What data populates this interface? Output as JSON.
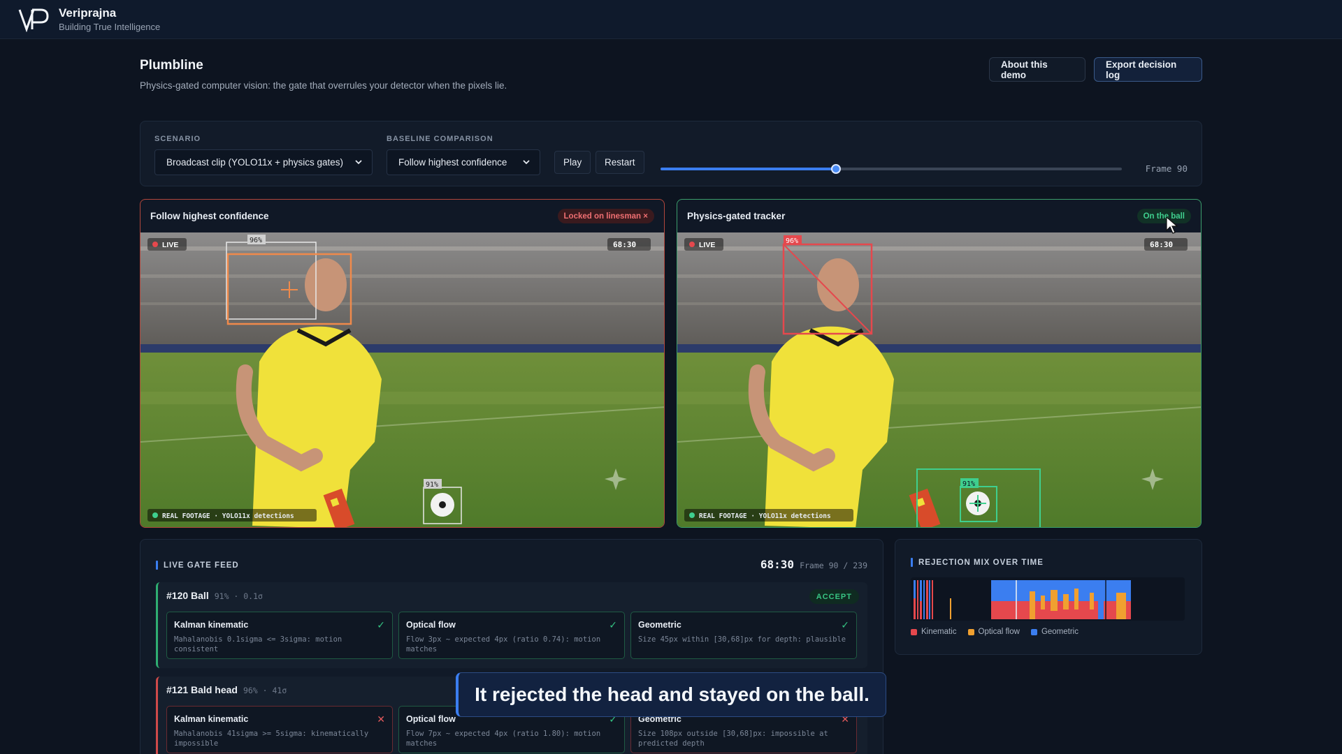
{
  "brand": {
    "name": "Veriprajna",
    "tagline": "Building True Intelligence",
    "logo_text": "VP"
  },
  "header": {
    "title": "Plumbline",
    "subtitle": "Physics-gated computer vision: the gate that overrules your detector when the pixels lie.",
    "about_button": "About this demo",
    "export_button": "Export decision log"
  },
  "controls": {
    "scenario_label": "SCENARIO",
    "scenario_value": "Broadcast clip (YOLO11x + physics gates)",
    "baseline_label": "BASELINE COMPARISON",
    "baseline_value": "Follow highest confidence",
    "play_button": "Play",
    "restart_button": "Restart",
    "frame_label": "Frame 90",
    "timeline_progress": 0.38
  },
  "panels": {
    "left": {
      "title": "Follow highest confidence",
      "status": "Locked on linesman ×",
      "live": "LIVE",
      "clock": "68:30",
      "footer": "REAL FOOTAGE · YOLO11x detections",
      "det_labels": [
        "96%",
        "91%"
      ]
    },
    "right": {
      "title": "Physics-gated tracker",
      "status": "On the ball",
      "live": "LIVE",
      "clock": "68:30",
      "footer": "REAL FOOTAGE · YOLO11x detections",
      "det_labels": [
        "96%",
        "91%"
      ]
    }
  },
  "feed": {
    "title": "LIVE GATE FEED",
    "clock": "68:30",
    "frame": "Frame 90 / 239",
    "detections": [
      {
        "id": "#120 Ball",
        "meta": "91% · 0.1σ",
        "verdict": "ACCEPT",
        "gates": [
          {
            "name": "Kalman kinematic",
            "mark": "✓",
            "text": "Mahalanobis 0.1sigma <= 3sigma: motion consistent"
          },
          {
            "name": "Optical flow",
            "mark": "✓",
            "text": "Flow 3px ~ expected 4px (ratio 0.74): motion matches"
          },
          {
            "name": "Geometric",
            "mark": "✓",
            "text": "Size 45px within [30,68]px for depth: plausible"
          }
        ]
      },
      {
        "id": "#121 Bald head",
        "meta": "96% · 41σ",
        "gates": [
          {
            "name": "Kalman kinematic",
            "mark": "✕",
            "text": "Mahalanobis 41sigma >= 5sigma: kinematically impossible"
          },
          {
            "name": "Optical flow",
            "mark": "✓",
            "text": "Flow 7px ~ expected 4px (ratio 1.80): motion matches"
          },
          {
            "name": "Geometric",
            "mark": "✕",
            "text": "Size 108px outside [30,68]px: impossible at predicted depth"
          }
        ]
      }
    ]
  },
  "mix": {
    "title": "REJECTION MIX OVER TIME",
    "legend": [
      {
        "label": "Kinematic",
        "color": "#e5484d"
      },
      {
        "label": "Optical flow",
        "color": "#f0a030"
      },
      {
        "label": "Geometric",
        "color": "#3b7ef0"
      }
    ]
  },
  "caption": "It rejected the head and stayed on the ball."
}
